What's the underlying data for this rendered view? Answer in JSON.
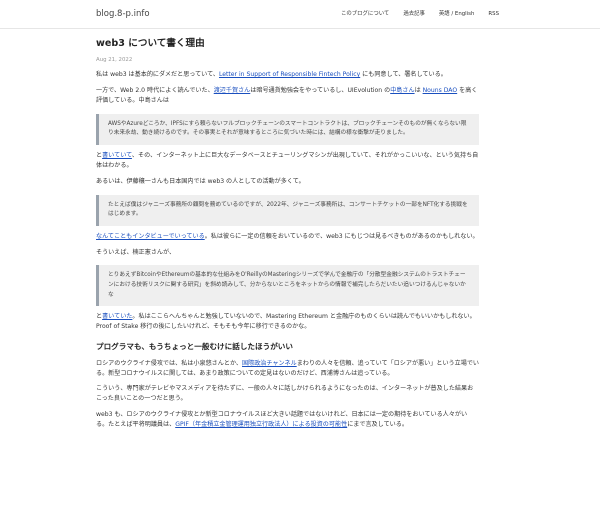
{
  "header": {
    "site_title": "blog.8-p.info",
    "nav": [
      {
        "label": "このブログについて"
      },
      {
        "label": "過去記事"
      },
      {
        "label": "英語 / English"
      },
      {
        "label": "RSS"
      }
    ]
  },
  "post": {
    "title": "web3 について書く理由",
    "date": "Aug 21, 2022",
    "p1": {
      "before": "私は web3 は基本的にダメだと思っていて、",
      "link": "Letter in Support of Responsible Fintech Policy",
      "after": " にも同意して、署名している。"
    },
    "p2": {
      "t1": "一方で、Web 2.0 時代によく読んでいた、",
      "l1": "渡辺千賀さん",
      "t2": "は暗号通貨勉強会をやっているし、UIEvolution の",
      "l2": "中島さん",
      "t3": "は ",
      "l3": "Nouns DAO",
      "t4": " を高く評価している。中島さんは"
    },
    "quote1": "AWSやAzureどころか、IPFSにすら頼らないフルブロックチェーンのスマートコントラクトは、ブロックチェーンそのものが無くならない限り未来永劫、動き続けるのです。その事実とそれが意味するところに気づいた時には、結構の様な衝撃が走りました。",
    "p3": {
      "before": "と",
      "link": "書いていて",
      "after": "、その、インターネット上に巨大なデータベースとチューリングマシンが出現していて、それがかっこいいな、という気持ち自体はわかる。"
    },
    "p4": "あるいは、伊藤穰一さんも日本国内では web3 の人としての活動が多くて。",
    "quote2": "たとえば僕はジャニーズ事務所の顧問を務めているのですが、2022年、ジャニーズ事務所は、コンサートチケットの一部をNFT化する挑戦をはじめます。",
    "p5": {
      "link": "なんてこともインタビューでいっている",
      "after": "。私は彼らに一定の信頼をおいているので、web3 にもじつは見るべきものがあるのかもしれない。"
    },
    "p6": "そういえば、楠正憲さんが、",
    "quote3": "とりあえずBitcoinやEthereumの基本的な仕組みをO'ReillyのMasteringシリーズで学んで金融庁の「分散型金融システムのトラストチェーンにおける技術リスクに関する研究」を斜め読みして、分からないところをネットからの情報で補完したらだいたい追いつけるんじゃないかな",
    "p7": {
      "before": "と",
      "link": "書いていた",
      "after": "。私はここらへんちゃんと勉強していないので、Mastering Ethereum と金融庁のものくらいは読んでもいいかもしれない。Proof of Stake 移行の後にしたいけれど、そもそも今年に移行できるのかな。"
    },
    "h2": "プログラマも、もうちょっと一般むけに話したほうがいい",
    "p8": {
      "before": "ロシアのウクライナ侵攻では、私は小泉悠さんとか、",
      "link": "国際政治チャンネル",
      "after": "まわりの人々を信頼、追っていて「ロシアが悪い」という立場でいる。新型コロナウイルスに関しては、あまり政策についての定見はないのだけど、西浦博さんは追っている。"
    },
    "p9": "こういう、専門家がテレビやマスメディアを待たずに、一般の人々に話しかけられるようになったのは、インターネットが普及した結果おこった良いことの一つだと思う。",
    "p10": {
      "before": "web3 も、ロシアのウクライナ侵攻とか新型コロナウイルスほど大きい話題ではないけれど、日本には一定の期待をおいている人々がいる。たとえば平将明議員は、",
      "link": "GPIF（年金積立金管理運用独立行政法人）による投資の可能性",
      "after": "にまで言及している。"
    }
  }
}
